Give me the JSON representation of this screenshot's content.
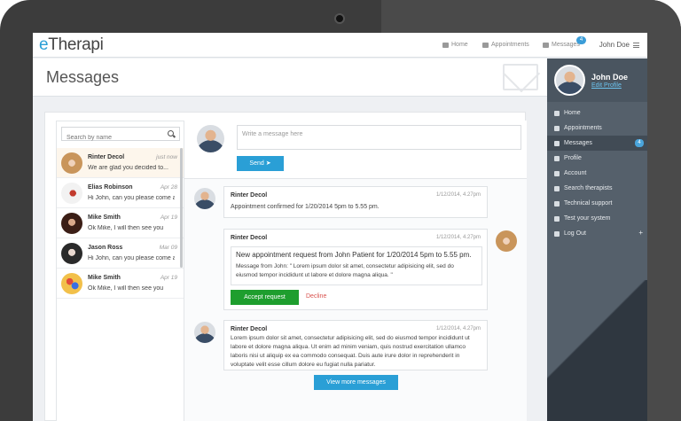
{
  "app": {
    "logo_e": "e",
    "logo_rest": "Therapi"
  },
  "topnav": {
    "home": "Home",
    "appointments": "Appointments",
    "messages": "Messages",
    "messages_badge": "4",
    "user": "John Doe"
  },
  "page": {
    "title": "Messages"
  },
  "search": {
    "placeholder": "Search by name"
  },
  "contacts": [
    {
      "name": "Rinter Decol",
      "date": "just now",
      "preview": "We are glad you decided to..."
    },
    {
      "name": "Elias Robinson",
      "date": "Apr 28",
      "preview": "Hi John, can you please come a"
    },
    {
      "name": "Mike Smith",
      "date": "Apr 19",
      "preview": "Ok Mike, I will then see you"
    },
    {
      "name": "Jason Ross",
      "date": "Mar 09",
      "preview": "Hi John, can you please come a"
    },
    {
      "name": "Mike Smith",
      "date": "Apr 19",
      "preview": "Ok Mike, I will then see you"
    }
  ],
  "compose": {
    "placeholder": "Write a message here",
    "send": "Send"
  },
  "messages": [
    {
      "name": "Rinter Decol",
      "time": "1/12/2014, 4.27pm",
      "text": "Appointment confirmed for 1/20/2014 5pm to 5.55 pm."
    },
    {
      "name": "Rinter Decol",
      "time": "1/12/2014, 4.27pm",
      "request_title": "New appointment request from John Patient for 1/20/2014 5pm to 5.55 pm.",
      "request_body": "Message from John: \" Lorem ipsum dolor sit amet, consectetur adipisicing elit, sed do eiusmod tempor incididunt ut labore et dolore magna aliqua. \"",
      "accept": "Accept request",
      "decline": "Decline"
    },
    {
      "name": "Rinter Decol",
      "time": "1/12/2014, 4.27pm",
      "text": "Lorem ipsum dolor sit amet, consectetur adipisicing elit, sed do eiusmod tempor incididunt ut labore et dolore magna aliqua. Ut enim ad minim veniam, quis nostrud exercitation ullamco laboris nisi ut aliquip ex ea commodo consequat. Duis aute irure dolor in reprehenderit in voluptate velit esse cillum dolore eu fugiat nulla pariatur."
    }
  ],
  "view_more": "View more messages",
  "sidebar": {
    "name": "John Doe",
    "edit": "Edit Profile",
    "items": [
      "Home",
      "Appointments",
      "Messages",
      "Profile",
      "Account",
      "Search therapists",
      "Technical support",
      "Test your system",
      "Log Out"
    ],
    "messages_badge": "4",
    "logout_plus": "+"
  }
}
